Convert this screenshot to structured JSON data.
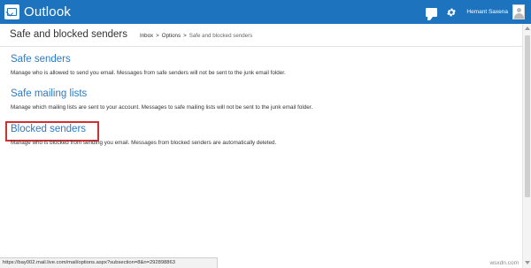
{
  "app": {
    "name": "Outlook"
  },
  "user": {
    "name": "Hemant Saxena"
  },
  "page": {
    "title": "Safe and blocked senders"
  },
  "breadcrumb": {
    "inbox": "Inbox",
    "sep1": ">",
    "options": "Options",
    "sep2": ">",
    "current": "Safe and blocked senders"
  },
  "sections": {
    "safe_senders": {
      "title": "Safe senders",
      "description": "Manage who is allowed to send you email. Messages from safe senders will not be sent to the junk email folder."
    },
    "safe_mailing_lists": {
      "title": "Safe mailing lists",
      "description": "Manage which mailing lists are sent to your account. Messages to safe mailing lists will not be sent to the junk email folder."
    },
    "blocked_senders": {
      "title": "Blocked senders",
      "description": "Manage who is blocked from sending you email. Messages from blocked senders are automatically deleted."
    }
  },
  "status_bar": {
    "url": "https://bay002.mail.live.com/mail/options.aspx?subsection=8&n=292898863"
  },
  "watermark": "wsxdn.com",
  "icons": {
    "logo": "outlook-logo-icon",
    "chat": "chat-icon",
    "settings": "gear-icon",
    "avatar": "avatar-icon"
  },
  "colors": {
    "topbar": "#1e73be",
    "link": "#2b7bc4",
    "highlight": "#d32f2f"
  }
}
